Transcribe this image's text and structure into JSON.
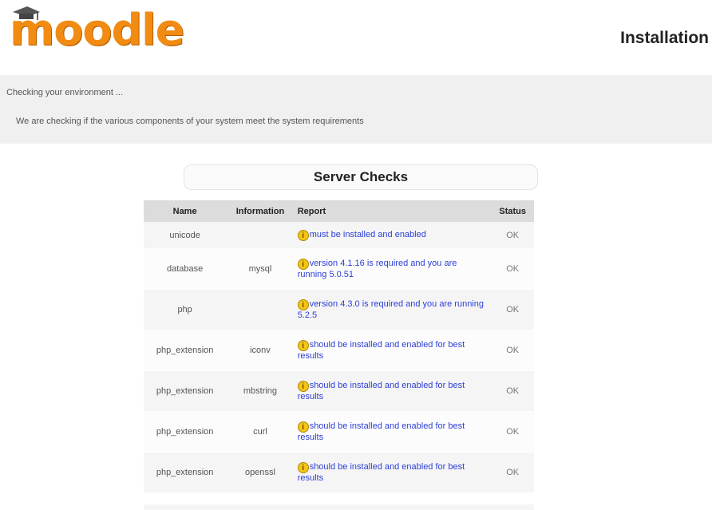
{
  "header": {
    "logo_text": "moodle",
    "page_heading": "Installation"
  },
  "environment": {
    "checking_label": "Checking your environment ...",
    "description": "We are checking if the various components of your system meet the system requirements"
  },
  "checks": {
    "title": "Server Checks",
    "columns": [
      "Name",
      "Information",
      "Report",
      "Status"
    ],
    "rows": [
      {
        "name": "unicode",
        "info": "",
        "report": "must be installed and enabled",
        "status": "OK"
      },
      {
        "name": "database",
        "info": "mysql",
        "report": "version 4.1.16 is required and you are running 5.0.51",
        "status": "OK"
      },
      {
        "name": "php",
        "info": "",
        "report": "version 4.3.0 is required and you are running 5.2.5",
        "status": "OK"
      },
      {
        "name": "php_extension",
        "info": "iconv",
        "report": "should be installed and enabled for best results",
        "status": "OK"
      },
      {
        "name": "php_extension",
        "info": "mbstring",
        "report": "should be installed and enabled for best results",
        "status": "OK"
      },
      {
        "name": "php_extension",
        "info": "curl",
        "report": "should be installed and enabled for best results",
        "status": "OK"
      },
      {
        "name": "php_extension",
        "info": "openssl",
        "report": "should be installed and enabled for best results",
        "status": "OK"
      }
    ],
    "warning_icon_glyph": "i"
  },
  "colors": {
    "logo_orange": "#f28b12",
    "link_blue": "#2c3fd6",
    "warning_yellow": "#f5c518"
  }
}
